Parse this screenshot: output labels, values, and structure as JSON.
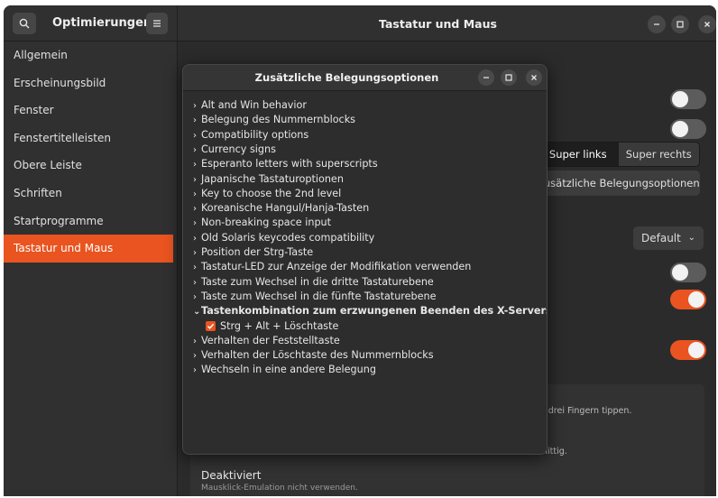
{
  "sidebar": {
    "title": "Optimierungen",
    "items": [
      {
        "label": "Allgemein"
      },
      {
        "label": "Erscheinungsbild"
      },
      {
        "label": "Fenster"
      },
      {
        "label": "Fenstertitelleisten"
      },
      {
        "label": "Obere Leiste"
      },
      {
        "label": "Schriften"
      },
      {
        "label": "Startprogramme"
      },
      {
        "label": "Tastatur und Maus",
        "active": true
      }
    ]
  },
  "header": {
    "title": "Tastatur und Maus"
  },
  "main": {
    "segment": {
      "left": "Super links",
      "right": "Super rechts",
      "selected": "Super links"
    },
    "additional_button": "Zusätzliche Belegungsoptionen",
    "dropdown_value": "Default",
    "toggles": [
      false,
      false,
      false,
      true,
      true
    ],
    "card_line_1": "t drei Fingern tippen.",
    "card_line_2": "hittig.",
    "deaktiviert": "Deaktiviert",
    "deaktiviert_sub": "Mausklick-Emulation nicht verwenden."
  },
  "dialog": {
    "title": "Zusätzliche Belegungsoptionen",
    "options": [
      {
        "label": "Alt and Win behavior"
      },
      {
        "label": "Belegung des Nummernblocks"
      },
      {
        "label": "Compatibility options"
      },
      {
        "label": "Currency signs"
      },
      {
        "label": "Esperanto letters with superscripts"
      },
      {
        "label": "Japanische Tastaturoptionen"
      },
      {
        "label": "Key to choose the 2nd level"
      },
      {
        "label": "Koreanische Hangul/Hanja-Tasten"
      },
      {
        "label": "Non-breaking space input"
      },
      {
        "label": "Old Solaris keycodes compatibility"
      },
      {
        "label": "Position der Strg-Taste"
      },
      {
        "label": "Tastatur-LED zur Anzeige der Modifikation verwenden"
      },
      {
        "label": "Taste zum Wechsel in die dritte Tastaturebene"
      },
      {
        "label": "Taste zum Wechsel in die fünfte Tastaturebene"
      },
      {
        "label": "Tastenkombination zum erzwungenen Beenden des X-Servers",
        "expanded": true
      },
      {
        "label": "Verhalten der Feststelltaste"
      },
      {
        "label": "Verhalten der Löschtaste des Nummernblocks"
      },
      {
        "label": "Wechseln in eine andere Belegung"
      }
    ],
    "sub_option": {
      "label": "Strg + Alt + Löschtaste",
      "checked": true
    }
  },
  "icons": {
    "search": "search-icon",
    "menu": "hamburger-menu-icon",
    "minimize": "minimize-icon",
    "maximize": "maximize-icon",
    "close": "close-icon",
    "collapsed": "chevron-right-icon",
    "expanded": "chevron-down-icon",
    "checkmark": "checkmark-icon"
  },
  "colors": {
    "accent": "#e95420",
    "window_bg": "#2b2b2b",
    "sidebar_bg": "#303030"
  }
}
